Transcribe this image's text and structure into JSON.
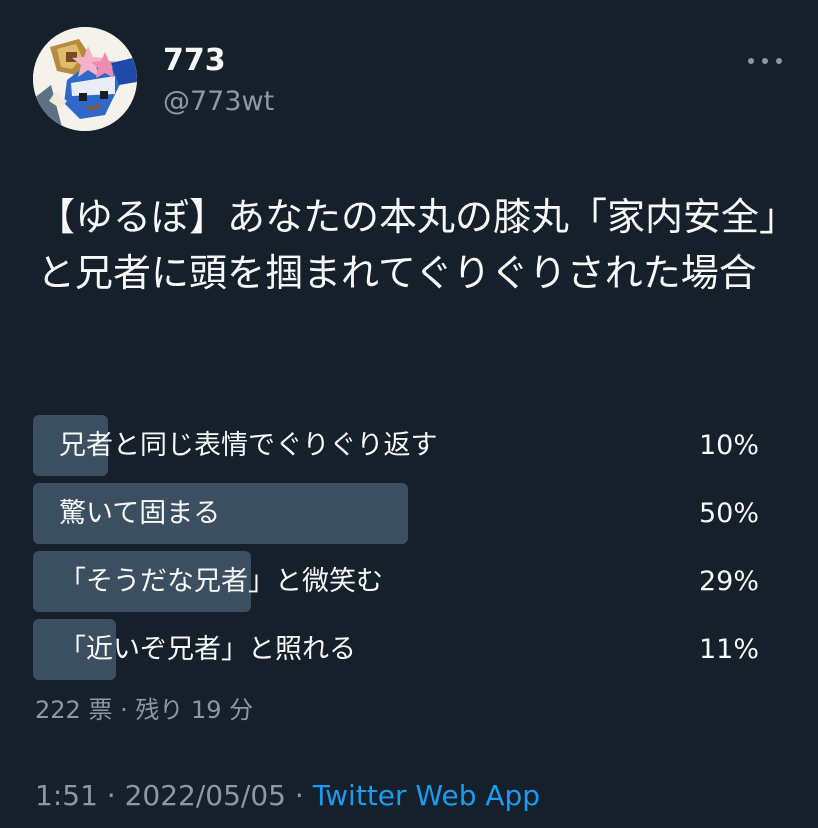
{
  "user": {
    "display_name": "773",
    "handle": "@773wt",
    "avatar": "avatar-image"
  },
  "more_icon": "more-horizontal-icon",
  "tweet": {
    "text": "【ゆるぼ】あなたの本丸の膝丸「家内安全」と兄者に頭を掴まれてぐりぐりされた場合"
  },
  "poll": {
    "options": [
      {
        "label": "兄者と同じ表情でぐりぐり返す",
        "percent": "10%",
        "value": 10
      },
      {
        "label": "驚いて固まる",
        "percent": "50%",
        "value": 50
      },
      {
        "label": "「そうだな兄者」と微笑む",
        "percent": "29%",
        "value": 29
      },
      {
        "label": "「近いぞ兄者」と照れる",
        "percent": "11%",
        "value": 11
      }
    ],
    "votes": "222 票",
    "separator": " · ",
    "remaining": "残り 19 分"
  },
  "timestamp": {
    "time": "1:51",
    "separator1": " · ",
    "date": "2022/05/05",
    "separator2": " · ",
    "source": "Twitter Web App"
  },
  "colors": {
    "background": "#15202b",
    "text": "#f7f9f9",
    "muted": "#8b98a5",
    "bar": "#3b4f60",
    "link": "#1d9bf0"
  }
}
